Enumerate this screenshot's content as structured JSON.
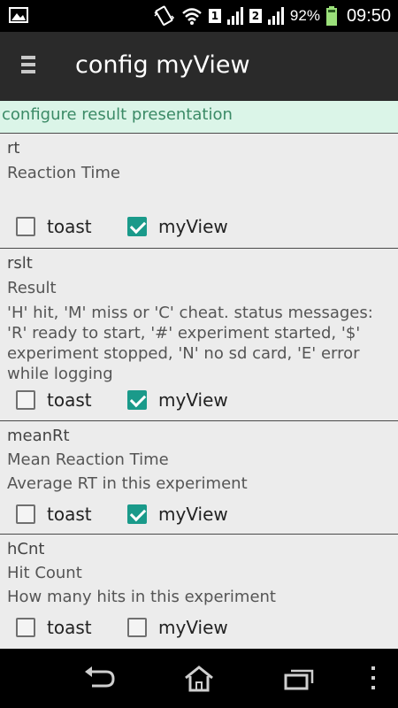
{
  "status_bar": {
    "sim1": "1",
    "sim2": "2",
    "battery_percent": "92%",
    "time": "09:50",
    "icons": [
      "image-icon",
      "vibrate-icon",
      "wifi-icon",
      "signal-icon",
      "signal-icon",
      "battery-icon"
    ]
  },
  "action_bar": {
    "title": "config myView",
    "icon": "menu-icon"
  },
  "subtitle": "configure result presentation",
  "colors": {
    "accent": "#1a9a8a",
    "subtitle_bg": "#dbf5e8",
    "subtitle_text": "#3b8a66",
    "action_bar_bg": "#2a2a2a"
  },
  "items": [
    {
      "key": "rt",
      "name": "Reaction Time",
      "description": "",
      "toast_label": "toast",
      "toast_checked": false,
      "myview_label": "myView",
      "myview_checked": true
    },
    {
      "key": "rslt",
      "name": "Result",
      "description": "'H' hit, 'M' miss or 'C' cheat. status messages: 'R' ready to start, '#' experiment started, '$' experiment stopped, 'N' no sd card, 'E' error while logging",
      "toast_label": "toast",
      "toast_checked": false,
      "myview_label": "myView",
      "myview_checked": true
    },
    {
      "key": "meanRt",
      "name": "Mean Reaction Time",
      "description": "Average RT in this experiment",
      "toast_label": "toast",
      "toast_checked": false,
      "myview_label": "myView",
      "myview_checked": true
    },
    {
      "key": "hCnt",
      "name": "Hit Count",
      "description": "How many hits in this experiment",
      "toast_label": "toast",
      "toast_checked": false,
      "myview_label": "myView",
      "myview_checked": false
    }
  ],
  "nav_bar": {
    "icons": [
      "back-icon",
      "home-icon",
      "recents-icon",
      "overflow-menu-icon"
    ]
  }
}
